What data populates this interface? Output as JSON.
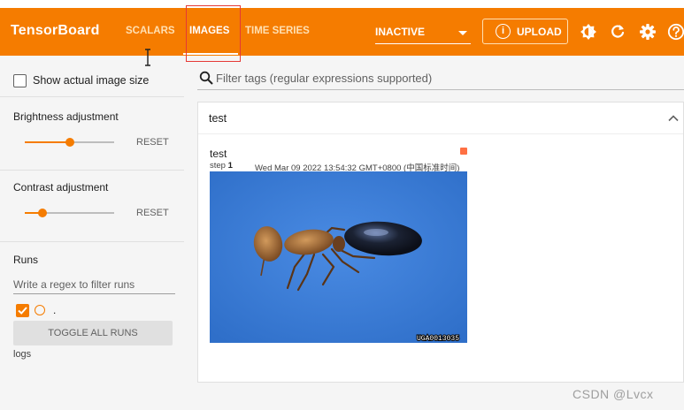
{
  "header": {
    "brand": "TensorBoard",
    "tabs": [
      {
        "label": "SCALARS",
        "active": false
      },
      {
        "label": "IMAGES",
        "active": true
      },
      {
        "label": "TIME SERIES",
        "active": false
      }
    ],
    "run_selector": "INACTIVE",
    "upload_label": "UPLOAD",
    "icons": [
      "brightness-icon",
      "refresh-icon",
      "settings-icon",
      "help-icon"
    ]
  },
  "sidebar": {
    "show_actual_size_label": "Show actual image size",
    "brightness": {
      "label": "Brightness adjustment",
      "reset": "RESET",
      "level": 0.5
    },
    "contrast": {
      "label": "Contrast adjustment",
      "reset": "RESET",
      "level": 0.2
    },
    "runs": {
      "label": "Runs",
      "filter_placeholder": "Write a regex to filter runs",
      "run_items": [
        {
          "name": ".",
          "checked": true
        }
      ],
      "toggle_label": "TOGGLE ALL RUNS",
      "logdir": "logs"
    }
  },
  "main": {
    "filter_placeholder": "Filter tags (regular expressions supported)",
    "card": {
      "title": "test",
      "image": {
        "title": "test",
        "step_label": "step",
        "step": "1",
        "timestamp": "Wed Mar 09 2022 13:54:32 GMT+0800 (中国标准时间)",
        "image_caption": "UGA0013035"
      }
    }
  },
  "watermark": "CSDN @Lvcx",
  "colors": {
    "accent": "#f57c00",
    "header_text": "#ffffff",
    "photo_bg": "#3d7fd8"
  }
}
